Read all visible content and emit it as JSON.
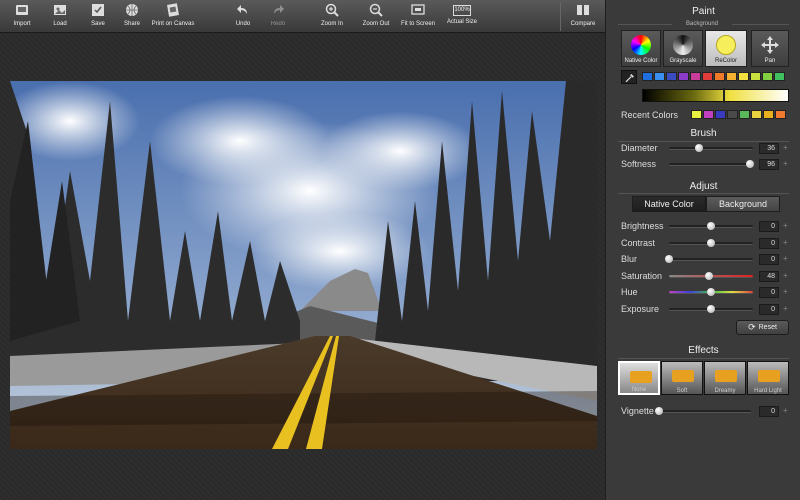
{
  "toolbar": {
    "import": "Import",
    "load": "Load",
    "save": "Save",
    "share": "Share",
    "print": "Print on Canvas",
    "undo": "Undo",
    "redo": "Redo",
    "zoom_in": "Zoom In",
    "zoom_out": "Zoom Out",
    "fit": "Fit to Screen",
    "actual": "Actual Size",
    "actual_icon_text": "100%",
    "compare": "Compare"
  },
  "paint": {
    "title": "Paint",
    "background_label": "Background",
    "modes": [
      "Native Color",
      "Grayscale",
      "ReColor",
      "Pan"
    ],
    "active_mode": "ReColor",
    "palette": [
      "#1f6fe0",
      "#3a8ff0",
      "#3b4cc0",
      "#8a3cc8",
      "#c83c9c",
      "#e03c3c",
      "#f07a2a",
      "#f4b030",
      "#f4e040",
      "#c8e040",
      "#80d040",
      "#40c060"
    ],
    "recent_label": "Recent Colors",
    "recent": [
      "#e8f040",
      "#c040c0",
      "#3a3ac0",
      "#4a4a4a",
      "#5ab85a",
      "#e8d040",
      "#e8b020",
      "#f07a30"
    ]
  },
  "brush": {
    "title": "Brush",
    "diameter_label": "Diameter",
    "diameter": 36,
    "softness_label": "Softness",
    "softness": 96
  },
  "adjust": {
    "title": "Adjust",
    "tab_native": "Native Color",
    "tab_background": "Background",
    "rows": [
      {
        "label": "Brightness",
        "value": 0,
        "pos": 0.5
      },
      {
        "label": "Contrast",
        "value": 0,
        "pos": 0.5
      },
      {
        "label": "Blur",
        "value": 0,
        "pos": 0.0
      },
      {
        "label": "Saturation",
        "value": 48,
        "pos": 0.48
      },
      {
        "label": "Hue",
        "value": 0,
        "pos": 0.5
      },
      {
        "label": "Exposure",
        "value": 0,
        "pos": 0.5
      }
    ],
    "reset": "Reset"
  },
  "effects": {
    "title": "Effects",
    "items": [
      "None",
      "Soft",
      "Dreamy",
      "Hard Light"
    ],
    "vignette_label": "Vignette",
    "vignette": 0
  },
  "colors": {
    "accent_selected": "#ffffff",
    "panel_bg": "#3a3a3a"
  }
}
